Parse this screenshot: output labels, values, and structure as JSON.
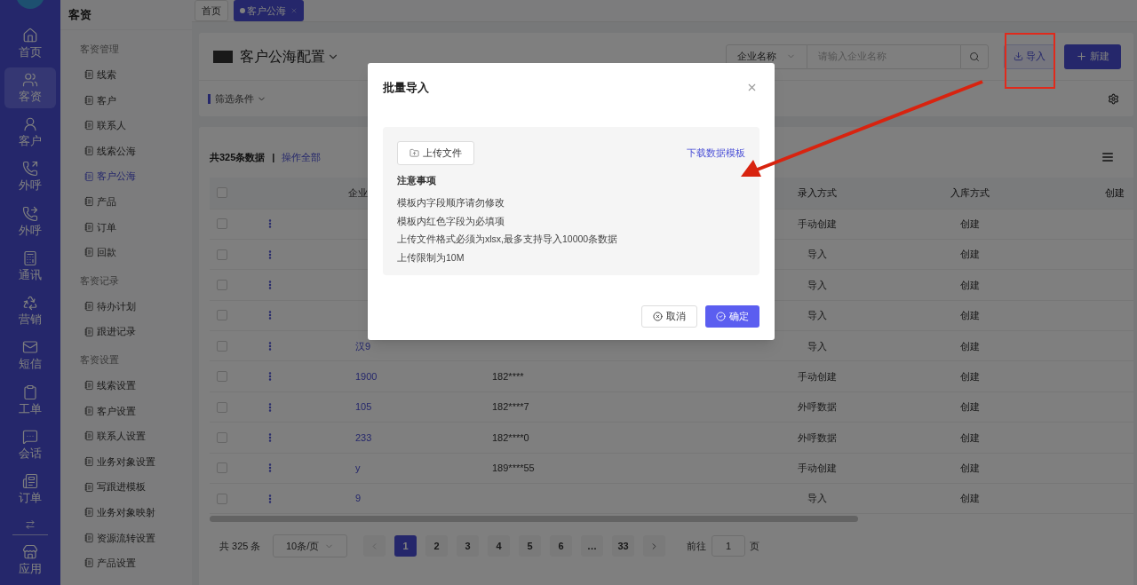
{
  "nav": {
    "items": [
      {
        "label": "首页",
        "selected": false
      },
      {
        "label": "客资",
        "selected": true
      },
      {
        "label": "客户",
        "selected": false
      },
      {
        "label": "外呼",
        "selected": false
      },
      {
        "label": "外呼",
        "selected": false
      },
      {
        "label": "通讯",
        "selected": false
      },
      {
        "label": "营销",
        "selected": false
      },
      {
        "label": "短信",
        "selected": false
      },
      {
        "label": "工单",
        "selected": false
      },
      {
        "label": "会话",
        "selected": false
      },
      {
        "label": "订单",
        "selected": false
      },
      {
        "label": "应用",
        "selected": false
      }
    ]
  },
  "sidebar": {
    "title": "客资",
    "groups": [
      {
        "title": "客资管理",
        "items": [
          {
            "label": "线索",
            "selected": false
          },
          {
            "label": "客户",
            "selected": false
          },
          {
            "label": "联系人",
            "selected": false
          },
          {
            "label": "线索公海",
            "selected": false
          },
          {
            "label": "客户公海",
            "selected": true
          },
          {
            "label": "产品",
            "selected": false
          },
          {
            "label": "订单",
            "selected": false
          },
          {
            "label": "回款",
            "selected": false
          }
        ]
      },
      {
        "title": "客资记录",
        "items": [
          {
            "label": "待办计划",
            "selected": false
          },
          {
            "label": "跟进记录",
            "selected": false
          }
        ]
      },
      {
        "title": "客资设置",
        "items": [
          {
            "label": "线索设置",
            "selected": false
          },
          {
            "label": "客户设置",
            "selected": false
          },
          {
            "label": "联系人设置",
            "selected": false
          },
          {
            "label": "业务对象设置",
            "selected": false
          },
          {
            "label": "写跟进模板",
            "selected": false
          },
          {
            "label": "业务对象映射",
            "selected": false
          },
          {
            "label": "资源流转设置",
            "selected": false
          },
          {
            "label": "产品设置",
            "selected": false
          }
        ]
      }
    ]
  },
  "page_tabs": [
    {
      "label": "首页",
      "selected": false,
      "closable": false
    },
    {
      "label": "客户公海",
      "selected": true,
      "closable": true
    }
  ],
  "header": {
    "title": "客户公海配置",
    "search_select": "企业名称",
    "search": {
      "placeholder": "请输入企业名称"
    },
    "import_button": "导入",
    "new_button": "新建"
  },
  "filter": {
    "label": "筛选条件"
  },
  "summary": {
    "count": "共325条数据",
    "separator": "|",
    "action": "操作全部"
  },
  "table": {
    "select_all": {
      "checked": false
    },
    "columns": [
      "企业",
      "录入方式",
      "入库方式",
      "创建"
    ],
    "rows": [
      {
        "checked": false,
        "entry": "手动创建",
        "storage": "创建"
      },
      {
        "checked": false,
        "entry": "导入",
        "storage": "创建"
      },
      {
        "checked": false,
        "entry": "导入",
        "storage": "创建"
      },
      {
        "checked": false,
        "entry": "导入",
        "storage": "创建"
      },
      {
        "checked": false,
        "company": "汉9",
        "entry": "导入",
        "storage": "创建"
      },
      {
        "checked": false,
        "company": "1900",
        "phone": "182****",
        "entry": "手动创建",
        "storage": "创建"
      },
      {
        "checked": false,
        "company": "105",
        "phone": "182****7",
        "entry": "外呼数据",
        "storage": "创建"
      },
      {
        "checked": false,
        "company": "233",
        "phone": "182****0",
        "entry": "外呼数据",
        "storage": "创建"
      },
      {
        "checked": false,
        "company": "y",
        "phone": "189****55",
        "entry": "手动创建",
        "storage": "创建"
      },
      {
        "checked": false,
        "company": "9",
        "entry": "导入",
        "storage": "创建"
      }
    ]
  },
  "pagination": {
    "total": "共 325 条",
    "page_size": "10条/页",
    "pages": [
      {
        "label": "1",
        "selected": true
      },
      {
        "label": "2",
        "selected": false
      },
      {
        "label": "3",
        "selected": false
      },
      {
        "label": "4",
        "selected": false
      },
      {
        "label": "5",
        "selected": false
      },
      {
        "label": "6",
        "selected": false
      },
      {
        "label": "…",
        "selected": false
      },
      {
        "label": "33",
        "selected": false
      }
    ],
    "goto_label": "前往",
    "goto_value": "1",
    "goto_suffix": "页"
  },
  "dialog": {
    "title": "批量导入",
    "upload_button": "上传文件",
    "template_link": "下载数据模板",
    "notes_title": "注意事项",
    "notes": [
      "模板内字段顺序请勿修改",
      "模板内红色字段为必填项",
      "上传文件格式必须为xlsx,最多支持导入10000条数据",
      "上传限制为10M"
    ],
    "cancel_button": "取消",
    "confirm_button": "确定"
  }
}
